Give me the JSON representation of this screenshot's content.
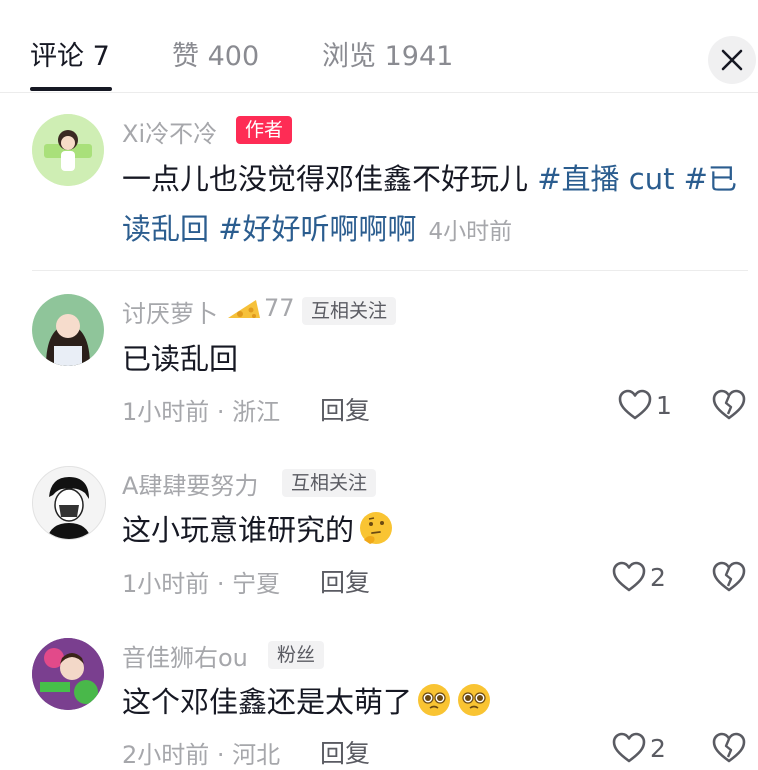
{
  "tabs": {
    "comments": "评论 7",
    "likes": "赞 400",
    "views": "浏览 1941"
  },
  "comments": [
    {
      "username": "Xi冷不冷",
      "badge": "作者",
      "text_plain": "一点儿也没觉得邓佳鑫不好玩儿 ",
      "hashtag1": "#直播 cut",
      "hashtag2_line1": " #已",
      "hashtag2_line2": "读乱回",
      "hashtag3": " #好好听啊啊啊",
      "time": "4小时前"
    },
    {
      "username": "讨厌萝卜",
      "fan_level": "77",
      "badge": "互相关注",
      "text": "已读乱回",
      "meta": "1小时前 · 浙江",
      "reply": "回复",
      "likes": "1"
    },
    {
      "username": "A肆肆要努力",
      "badge": "互相关注",
      "text": "这小玩意谁研究的",
      "emoji": "thinking-face-emoji",
      "meta": "1小时前 · 宁夏",
      "reply": "回复",
      "likes": "2"
    },
    {
      "username": "音佳狮右ou",
      "badge": "粉丝",
      "text": "这个邓佳鑫还是太萌了",
      "emoji": "pleading-face-emoji",
      "meta": "2小时前 · 河北",
      "reply": "回复",
      "likes": "2"
    }
  ],
  "colors": {
    "hashtag": "#2b5d8f",
    "author_badge": "#fe2c55",
    "muted": "#a6a7ab"
  },
  "icons": [
    "close-icon",
    "heart-icon",
    "broken-heart-icon",
    "cheese-icon"
  ]
}
